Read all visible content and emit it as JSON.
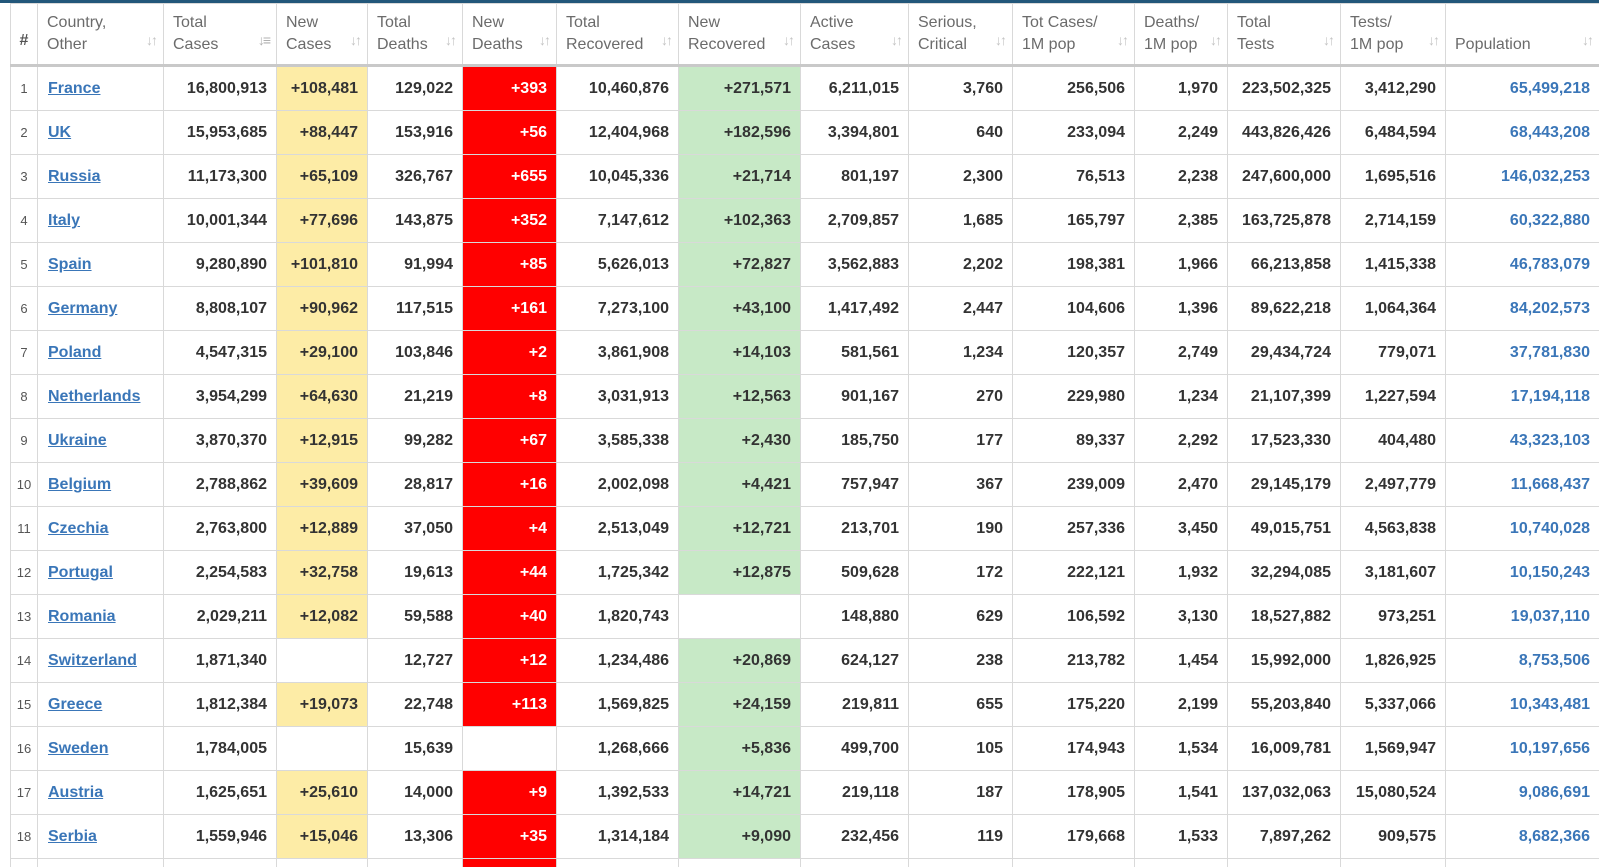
{
  "colors": {
    "new_cases_bg": "#fdeca6",
    "new_deaths_bg": "#ff0000",
    "new_recovered_bg": "#c7e9c6",
    "link": "#3a76b8"
  },
  "headers": [
    {
      "key": "idx",
      "line1": "#",
      "line2": ""
    },
    {
      "key": "country",
      "line1": "Country,",
      "line2": "Other"
    },
    {
      "key": "total_cases",
      "line1": "Total",
      "line2": "Cases"
    },
    {
      "key": "new_cases",
      "line1": "New",
      "line2": "Cases"
    },
    {
      "key": "total_deaths",
      "line1": "Total",
      "line2": "Deaths"
    },
    {
      "key": "new_deaths",
      "line1": "New",
      "line2": "Deaths"
    },
    {
      "key": "total_recovered",
      "line1": "Total",
      "line2": "Recovered"
    },
    {
      "key": "new_recovered",
      "line1": "New",
      "line2": "Recovered"
    },
    {
      "key": "active_cases",
      "line1": "Active",
      "line2": "Cases"
    },
    {
      "key": "serious",
      "line1": "Serious,",
      "line2": "Critical"
    },
    {
      "key": "cases_per_m",
      "line1": "Tot Cases/",
      "line2": "1M pop"
    },
    {
      "key": "deaths_per_m",
      "line1": "Deaths/",
      "line2": "1M pop"
    },
    {
      "key": "total_tests",
      "line1": "Total",
      "line2": "Tests"
    },
    {
      "key": "tests_per_m",
      "line1": "Tests/",
      "line2": "1M pop"
    },
    {
      "key": "population",
      "line1": "",
      "line2": "Population"
    }
  ],
  "sorted_column": "total_cases",
  "rows": [
    {
      "idx": "1",
      "country": "France",
      "total_cases": "16,800,913",
      "new_cases": "+108,481",
      "total_deaths": "129,022",
      "new_deaths": "+393",
      "total_recovered": "10,460,876",
      "new_recovered": "+271,571",
      "active_cases": "6,211,015",
      "serious": "3,760",
      "cases_per_m": "256,506",
      "deaths_per_m": "1,970",
      "total_tests": "223,502,325",
      "tests_per_m": "3,412,290",
      "population": "65,499,218"
    },
    {
      "idx": "2",
      "country": "UK",
      "total_cases": "15,953,685",
      "new_cases": "+88,447",
      "total_deaths": "153,916",
      "new_deaths": "+56",
      "total_recovered": "12,404,968",
      "new_recovered": "+182,596",
      "active_cases": "3,394,801",
      "serious": "640",
      "cases_per_m": "233,094",
      "deaths_per_m": "2,249",
      "total_tests": "443,826,426",
      "tests_per_m": "6,484,594",
      "population": "68,443,208"
    },
    {
      "idx": "3",
      "country": "Russia",
      "total_cases": "11,173,300",
      "new_cases": "+65,109",
      "total_deaths": "326,767",
      "new_deaths": "+655",
      "total_recovered": "10,045,336",
      "new_recovered": "+21,714",
      "active_cases": "801,197",
      "serious": "2,300",
      "cases_per_m": "76,513",
      "deaths_per_m": "2,238",
      "total_tests": "247,600,000",
      "tests_per_m": "1,695,516",
      "population": "146,032,253"
    },
    {
      "idx": "4",
      "country": "Italy",
      "total_cases": "10,001,344",
      "new_cases": "+77,696",
      "total_deaths": "143,875",
      "new_deaths": "+352",
      "total_recovered": "7,147,612",
      "new_recovered": "+102,363",
      "active_cases": "2,709,857",
      "serious": "1,685",
      "cases_per_m": "165,797",
      "deaths_per_m": "2,385",
      "total_tests": "163,725,878",
      "tests_per_m": "2,714,159",
      "population": "60,322,880"
    },
    {
      "idx": "5",
      "country": "Spain",
      "total_cases": "9,280,890",
      "new_cases": "+101,810",
      "total_deaths": "91,994",
      "new_deaths": "+85",
      "total_recovered": "5,626,013",
      "new_recovered": "+72,827",
      "active_cases": "3,562,883",
      "serious": "2,202",
      "cases_per_m": "198,381",
      "deaths_per_m": "1,966",
      "total_tests": "66,213,858",
      "tests_per_m": "1,415,338",
      "population": "46,783,079"
    },
    {
      "idx": "6",
      "country": "Germany",
      "total_cases": "8,808,107",
      "new_cases": "+90,962",
      "total_deaths": "117,515",
      "new_deaths": "+161",
      "total_recovered": "7,273,100",
      "new_recovered": "+43,100",
      "active_cases": "1,417,492",
      "serious": "2,447",
      "cases_per_m": "104,606",
      "deaths_per_m": "1,396",
      "total_tests": "89,622,218",
      "tests_per_m": "1,064,364",
      "population": "84,202,573"
    },
    {
      "idx": "7",
      "country": "Poland",
      "total_cases": "4,547,315",
      "new_cases": "+29,100",
      "total_deaths": "103,846",
      "new_deaths": "+2",
      "total_recovered": "3,861,908",
      "new_recovered": "+14,103",
      "active_cases": "581,561",
      "serious": "1,234",
      "cases_per_m": "120,357",
      "deaths_per_m": "2,749",
      "total_tests": "29,434,724",
      "tests_per_m": "779,071",
      "population": "37,781,830"
    },
    {
      "idx": "8",
      "country": "Netherlands",
      "total_cases": "3,954,299",
      "new_cases": "+64,630",
      "total_deaths": "21,219",
      "new_deaths": "+8",
      "total_recovered": "3,031,913",
      "new_recovered": "+12,563",
      "active_cases": "901,167",
      "serious": "270",
      "cases_per_m": "229,980",
      "deaths_per_m": "1,234",
      "total_tests": "21,107,399",
      "tests_per_m": "1,227,594",
      "population": "17,194,118"
    },
    {
      "idx": "9",
      "country": "Ukraine",
      "total_cases": "3,870,370",
      "new_cases": "+12,915",
      "total_deaths": "99,282",
      "new_deaths": "+67",
      "total_recovered": "3,585,338",
      "new_recovered": "+2,430",
      "active_cases": "185,750",
      "serious": "177",
      "cases_per_m": "89,337",
      "deaths_per_m": "2,292",
      "total_tests": "17,523,330",
      "tests_per_m": "404,480",
      "population": "43,323,103"
    },
    {
      "idx": "10",
      "country": "Belgium",
      "total_cases": "2,788,862",
      "new_cases": "+39,609",
      "total_deaths": "28,817",
      "new_deaths": "+16",
      "total_recovered": "2,002,098",
      "new_recovered": "+4,421",
      "active_cases": "757,947",
      "serious": "367",
      "cases_per_m": "239,009",
      "deaths_per_m": "2,470",
      "total_tests": "29,145,179",
      "tests_per_m": "2,497,779",
      "population": "11,668,437"
    },
    {
      "idx": "11",
      "country": "Czechia",
      "total_cases": "2,763,800",
      "new_cases": "+12,889",
      "total_deaths": "37,050",
      "new_deaths": "+4",
      "total_recovered": "2,513,049",
      "new_recovered": "+12,721",
      "active_cases": "213,701",
      "serious": "190",
      "cases_per_m": "257,336",
      "deaths_per_m": "3,450",
      "total_tests": "49,015,751",
      "tests_per_m": "4,563,838",
      "population": "10,740,028"
    },
    {
      "idx": "12",
      "country": "Portugal",
      "total_cases": "2,254,583",
      "new_cases": "+32,758",
      "total_deaths": "19,613",
      "new_deaths": "+44",
      "total_recovered": "1,725,342",
      "new_recovered": "+12,875",
      "active_cases": "509,628",
      "serious": "172",
      "cases_per_m": "222,121",
      "deaths_per_m": "1,932",
      "total_tests": "32,294,085",
      "tests_per_m": "3,181,607",
      "population": "10,150,243"
    },
    {
      "idx": "13",
      "country": "Romania",
      "total_cases": "2,029,211",
      "new_cases": "+12,082",
      "total_deaths": "59,588",
      "new_deaths": "+40",
      "total_recovered": "1,820,743",
      "new_recovered": "",
      "active_cases": "148,880",
      "serious": "629",
      "cases_per_m": "106,592",
      "deaths_per_m": "3,130",
      "total_tests": "18,527,882",
      "tests_per_m": "973,251",
      "population": "19,037,110"
    },
    {
      "idx": "14",
      "country": "Switzerland",
      "total_cases": "1,871,340",
      "new_cases": "",
      "total_deaths": "12,727",
      "new_deaths": "+12",
      "total_recovered": "1,234,486",
      "new_recovered": "+20,869",
      "active_cases": "624,127",
      "serious": "238",
      "cases_per_m": "213,782",
      "deaths_per_m": "1,454",
      "total_tests": "15,992,000",
      "tests_per_m": "1,826,925",
      "population": "8,753,506"
    },
    {
      "idx": "15",
      "country": "Greece",
      "total_cases": "1,812,384",
      "new_cases": "+19,073",
      "total_deaths": "22,748",
      "new_deaths": "+113",
      "total_recovered": "1,569,825",
      "new_recovered": "+24,159",
      "active_cases": "219,811",
      "serious": "655",
      "cases_per_m": "175,220",
      "deaths_per_m": "2,199",
      "total_tests": "55,203,840",
      "tests_per_m": "5,337,066",
      "population": "10,343,481"
    },
    {
      "idx": "16",
      "country": "Sweden",
      "total_cases": "1,784,005",
      "new_cases": "",
      "total_deaths": "15,639",
      "new_deaths": "",
      "total_recovered": "1,268,666",
      "new_recovered": "+5,836",
      "active_cases": "499,700",
      "serious": "105",
      "cases_per_m": "174,943",
      "deaths_per_m": "1,534",
      "total_tests": "16,009,781",
      "tests_per_m": "1,569,947",
      "population": "10,197,656"
    },
    {
      "idx": "17",
      "country": "Austria",
      "total_cases": "1,625,651",
      "new_cases": "+25,610",
      "total_deaths": "14,000",
      "new_deaths": "+9",
      "total_recovered": "1,392,533",
      "new_recovered": "+14,721",
      "active_cases": "219,118",
      "serious": "187",
      "cases_per_m": "178,905",
      "deaths_per_m": "1,541",
      "total_tests": "137,032,063",
      "tests_per_m": "15,080,524",
      "population": "9,086,691"
    },
    {
      "idx": "18",
      "country": "Serbia",
      "total_cases": "1,559,946",
      "new_cases": "+15,046",
      "total_deaths": "13,306",
      "new_deaths": "+35",
      "total_recovered": "1,314,184",
      "new_recovered": "+9,090",
      "active_cases": "232,456",
      "serious": "119",
      "cases_per_m": "179,668",
      "deaths_per_m": "1,533",
      "total_tests": "7,897,262",
      "tests_per_m": "909,575",
      "population": "8,682,366"
    },
    {
      "idx": "",
      "country": "",
      "total_cases": "",
      "new_cases": "",
      "total_deaths": "",
      "new_deaths": "",
      "total_recovered": "",
      "new_recovered": "",
      "active_cases": "",
      "serious": "",
      "cases_per_m": "",
      "deaths_per_m": "",
      "total_tests": "",
      "tests_per_m": "",
      "population": ""
    }
  ]
}
